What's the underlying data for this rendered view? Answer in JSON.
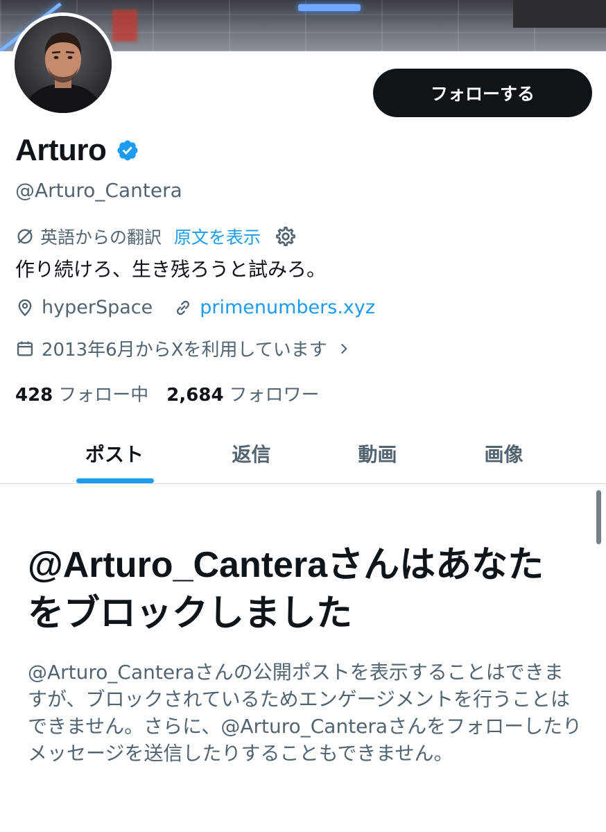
{
  "profile": {
    "name": "Arturo",
    "handle": "@Arturo_Cantera",
    "follow_button_label": "フォローする",
    "translation_note": "英語からの翻訳",
    "show_original_label": "原文を表示",
    "bio": "作り続けろ、生き残ろうと試みろ。",
    "location": "hyperSpace",
    "website": "primenumbers.xyz",
    "join_date": "2013年6月からXを利用しています",
    "following_count": "428",
    "following_label": "フォロー中",
    "followers_count": "2,684",
    "followers_label": "フォロワー"
  },
  "tabs": [
    {
      "label": "ポスト",
      "active": true
    },
    {
      "label": "返信",
      "active": false
    },
    {
      "label": "動画",
      "active": false
    },
    {
      "label": "画像",
      "active": false
    }
  ],
  "blocked": {
    "title": "@Arturo_Canteraさんはあなたをブロックしました",
    "body": "@Arturo_Canteraさんの公開ポストを表示することはできますが、ブロックされているためエンゲージメントを行うことはできません。さらに、@Arturo_Canteraさんをフォローしたりメッセージを送信したりすることもできません。"
  },
  "icons": {
    "verified": "verified-badge-icon",
    "translate": "translate-icon",
    "settings": "gear-icon",
    "location": "location-pin-icon",
    "link": "link-icon",
    "calendar": "calendar-icon",
    "chevron": "chevron-right-icon"
  },
  "colors": {
    "accent": "#1d9bf0",
    "text_primary": "#0f1419",
    "text_secondary": "#536471",
    "button_bg": "#0f1419"
  }
}
